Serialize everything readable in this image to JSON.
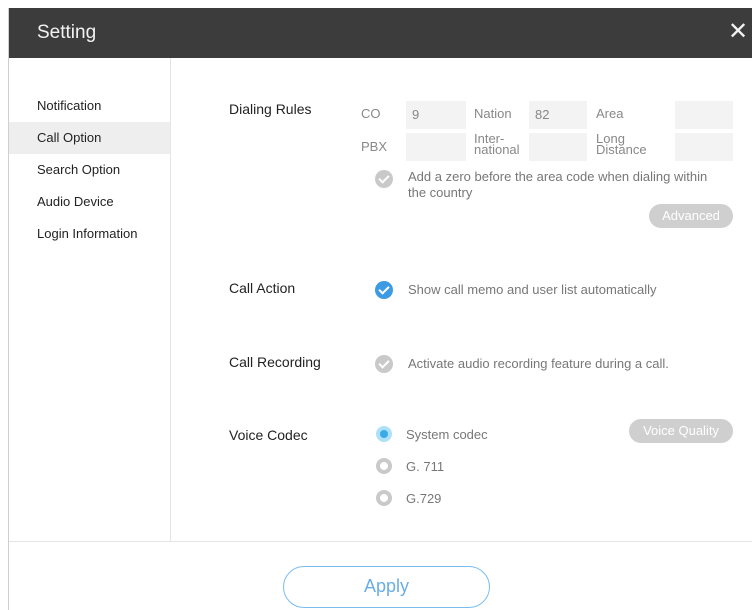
{
  "window": {
    "title": "Setting",
    "close_icon": "close-icon"
  },
  "sidebar": {
    "items": [
      {
        "label": "Notification"
      },
      {
        "label": "Call Option"
      },
      {
        "label": "Search Option"
      },
      {
        "label": "Audio Device"
      },
      {
        "label": "Login Information"
      }
    ],
    "active": "Call Option"
  },
  "dialing_rules": {
    "label": "Dialing Rules",
    "co_label": "CO",
    "co_value": "9",
    "nation_label": "Nation",
    "nation_value": "82",
    "area_label": "Area",
    "area_value": "",
    "pbx_label": "PBX",
    "pbx_value": "",
    "international_label_line1": "Inter-",
    "international_label_line2": "national",
    "international_value": "",
    "long_distance_label_line1": "Long",
    "long_distance_label_line2": "Distance",
    "long_distance_value": "",
    "add_zero_text_line1": "Add a zero before the area code when dialing within",
    "add_zero_text_line2": "the country",
    "add_zero_checked": false,
    "advanced_label": "Advanced"
  },
  "call_action": {
    "label": "Call Action",
    "option_text": "Show call memo and user list automatically",
    "checked": true
  },
  "call_recording": {
    "label": "Call Recording",
    "option_text": "Activate audio recording feature during a call.",
    "checked": false
  },
  "voice_codec": {
    "label": "Voice Codec",
    "options": [
      "System codec",
      "G. 711",
      "G.729"
    ],
    "selected": "System codec",
    "voice_quality_label": "Voice Quality"
  },
  "footer": {
    "apply_label": "Apply"
  },
  "colors": {
    "titlebar": "#3c3c3c",
    "accent": "#3c9be3",
    "check_off": "#c9c9c9",
    "button_gray": "#cfcfcf"
  }
}
